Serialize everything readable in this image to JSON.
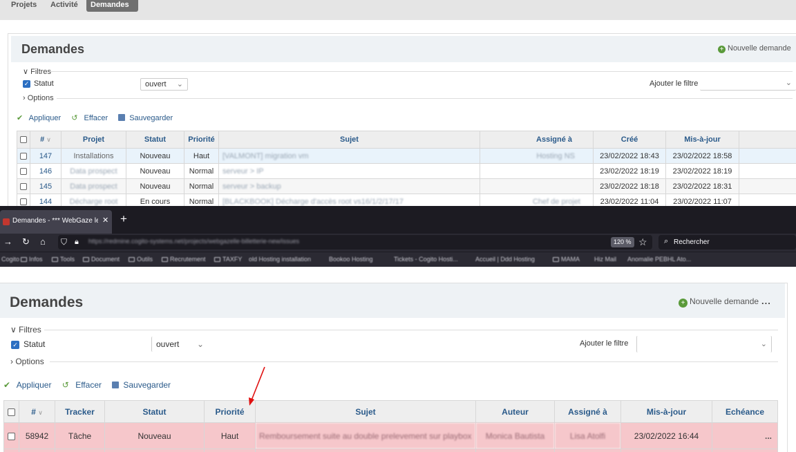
{
  "top_nav": {
    "tabs": [
      "Projets",
      "Activité",
      "Demandes"
    ],
    "active": "Demandes"
  },
  "top_panel": {
    "title": "Demandes",
    "new_issue": "Nouvelle demande",
    "filters_legend": "Filtres",
    "status_label": "Statut",
    "status_value": "ouvert",
    "add_filter_label": "Ajouter le filtre",
    "options_legend": "Options",
    "actions": {
      "apply": "Appliquer",
      "clear": "Effacer",
      "save": "Sauvegarder"
    },
    "columns": [
      "#",
      "Projet",
      "Statut",
      "Priorité",
      "Sujet",
      "Assigné à",
      "Créé",
      "Mis-à-jour"
    ],
    "rows": [
      {
        "id": "147",
        "project": "Installations",
        "status": "Nouveau",
        "priority": "Haut",
        "subject": "[VALMONT] migration vm",
        "assignee": "Hosting NS",
        "created": "23/02/2022 18:43",
        "updated": "23/02/2022 18:58"
      },
      {
        "id": "146",
        "project": "Data prospect",
        "status": "Nouveau",
        "priority": "Normal",
        "subject": "serveur > IP",
        "assignee": "",
        "created": "23/02/2022 18:19",
        "updated": "23/02/2022 18:19"
      },
      {
        "id": "145",
        "project": "Data prospect",
        "status": "Nouveau",
        "priority": "Normal",
        "subject": "serveur > backup",
        "assignee": "",
        "created": "23/02/2022 18:18",
        "updated": "23/02/2022 18:31"
      },
      {
        "id": "144",
        "project": "Décharge root",
        "status": "En cours",
        "priority": "Normal",
        "subject": "[BLACKBOOK] Décharge d'accès root vs16/1/2/17/17",
        "assignee": "Chef de projet",
        "created": "23/02/2022 11:04",
        "updated": "23/02/2022 11:07"
      }
    ]
  },
  "browser": {
    "tab_title": "Demandes - *** WebGaze le Bi",
    "new_tab": "+",
    "url": "https://redmine.cogito-systems.net/projects/webgazelle-billetterie-new/issues",
    "zoom": "120 %",
    "search_placeholder": "Rechercher",
    "bookmarks": [
      "Cogito",
      "Infos",
      "Tools",
      "Document",
      "Outils",
      "Recrutement",
      "TAXFY",
      "old Hosting installation",
      "Bookoo Hosting",
      "Tickets - Cogito Hosti...",
      "Accueil | Ddd Hosting",
      "MAMA",
      "Hiz Mail",
      "Anomalie PEBHL Ato..."
    ]
  },
  "bottom_panel": {
    "title": "Demandes",
    "new_issue": "Nouvelle demande",
    "more": "...",
    "filters_legend": "Filtres",
    "status_label": "Statut",
    "status_value": "ouvert",
    "add_filter_label": "Ajouter le filtre",
    "options_legend": "Options",
    "actions": {
      "apply": "Appliquer",
      "clear": "Effacer",
      "save": "Sauvegarder"
    },
    "columns": [
      "#",
      "Tracker",
      "Statut",
      "Priorité",
      "Sujet",
      "Auteur",
      "Assigné à",
      "Mis-à-jour",
      "Echéance"
    ],
    "rows": [
      {
        "id": "58942",
        "tracker": "Tâche",
        "status": "Nouveau",
        "priority": "Haut",
        "subject": "Remboursement suite au double prelevement sur playbox",
        "author": "Monica Bautista",
        "assignee": "Lisa Atolfi",
        "updated": "23/02/2022 16:44",
        "due": "",
        "more": "..."
      }
    ]
  },
  "colors": {
    "accent_link": "#2a5a8a",
    "high_priority_row": "#f6c7cb",
    "annotation_arrow": "#e01010",
    "browser_dark": "#1c1b22"
  }
}
